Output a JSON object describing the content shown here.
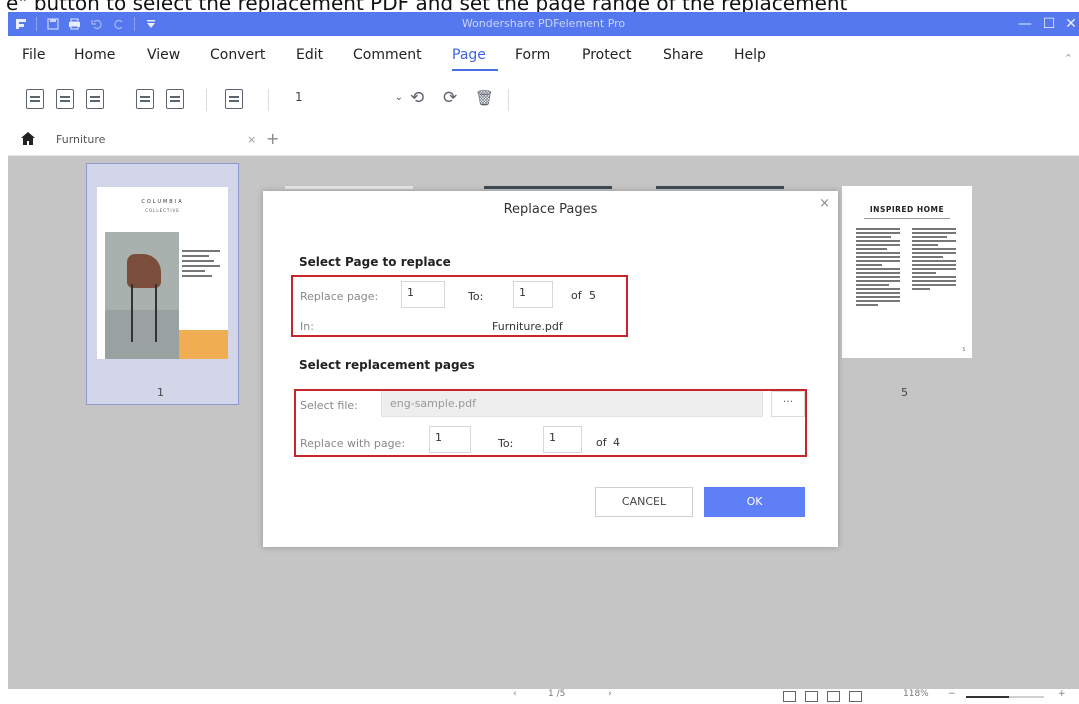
{
  "caption": "e\" button to select the replacement PDF and set the page range of the replacement",
  "window": {
    "title": "Wondershare PDFelement Pro",
    "minimize": "—",
    "maximize": "☐",
    "close": "✕"
  },
  "menu": {
    "items": [
      "File",
      "Home",
      "View",
      "Convert",
      "Edit",
      "Comment",
      "Page",
      "Form",
      "Protect",
      "Share",
      "Help"
    ],
    "active": "Page"
  },
  "toolbar": {
    "page_select_value": "1",
    "icons": [
      "extract-pages-icon",
      "insert-pages-icon",
      "replace-pages-icon",
      "split-pages-icon",
      "crop-pages-icon",
      "page-labels-icon",
      "rotate-left-icon",
      "rotate-right-icon",
      "delete-page-icon"
    ]
  },
  "tabs": {
    "home_icon": "home-icon",
    "document": "Furniture",
    "close": "×",
    "add": "+"
  },
  "thumbnails": {
    "page1": {
      "brand": "COLUMBIA",
      "brand2": "COLLECTIVE",
      "number": "1"
    },
    "page5": {
      "heading": "INSPIRED HOME",
      "number": "5",
      "page_mark": "5"
    }
  },
  "dialog": {
    "title": "Replace Pages",
    "close": "×",
    "section1_title": "Select Page to replace",
    "replace_page_label": "Replace page:",
    "replace_page_from": "1",
    "to_label": "To:",
    "replace_page_to": "1",
    "of_label": "of",
    "total_pages": "5",
    "in_label": "In:",
    "in_file": "Furniture.pdf",
    "section2_title": "Select replacement pages",
    "select_file_label": "Select file:",
    "select_file_value": "eng-sample.pdf",
    "browse": "···",
    "replace_with_label": "Replace with page:",
    "replace_with_from": "1",
    "replace_with_to": "1",
    "replacement_total": "4",
    "cancel": "CANCEL",
    "ok": "OK"
  },
  "status": {
    "page_indicator": "1 /5",
    "zoom": "118%",
    "zoom_fraction": 0.55
  },
  "colors": {
    "titlebar": "#5578ef",
    "ok_button": "#5f7ff6",
    "highlight_box": "#c9242b",
    "canvas": "#c5c5c5"
  }
}
